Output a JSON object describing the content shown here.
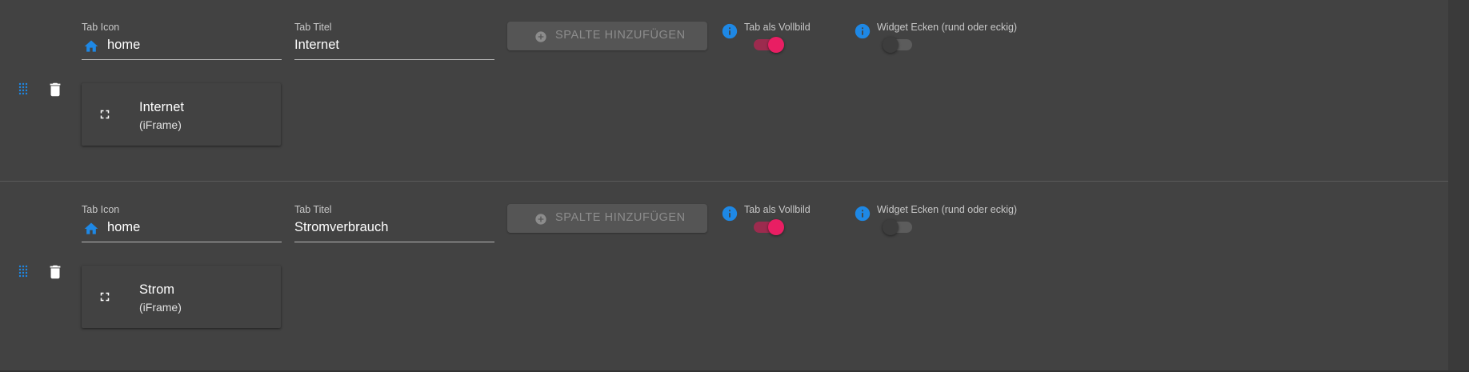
{
  "colors": {
    "accent_blue": "#1e88e5",
    "switch_on": "#e91e63",
    "background": "#424242"
  },
  "tabs": [
    {
      "tab_icon": {
        "label": "Tab Icon",
        "value": "home",
        "icon": "home-icon"
      },
      "tab_title": {
        "label": "Tab Titel",
        "value": "Internet"
      },
      "add_column_label": "SPALTE HINZUFÜGEN",
      "fullscreen": {
        "label": "Tab als Vollbild",
        "on": true
      },
      "corners": {
        "label": "Widget Ecken (rund oder eckig)",
        "on": false
      },
      "widgets": [
        {
          "name": "Internet",
          "type": "(iFrame)",
          "icon": "fullscreen-icon"
        }
      ]
    },
    {
      "tab_icon": {
        "label": "Tab Icon",
        "value": "home",
        "icon": "home-icon"
      },
      "tab_title": {
        "label": "Tab Titel",
        "value": "Stromverbrauch"
      },
      "add_column_label": "SPALTE HINZUFÜGEN",
      "fullscreen": {
        "label": "Tab als Vollbild",
        "on": true
      },
      "corners": {
        "label": "Widget Ecken (rund oder eckig)",
        "on": false
      },
      "widgets": [
        {
          "name": "Strom",
          "type": "(iFrame)",
          "icon": "fullscreen-icon"
        }
      ]
    }
  ]
}
